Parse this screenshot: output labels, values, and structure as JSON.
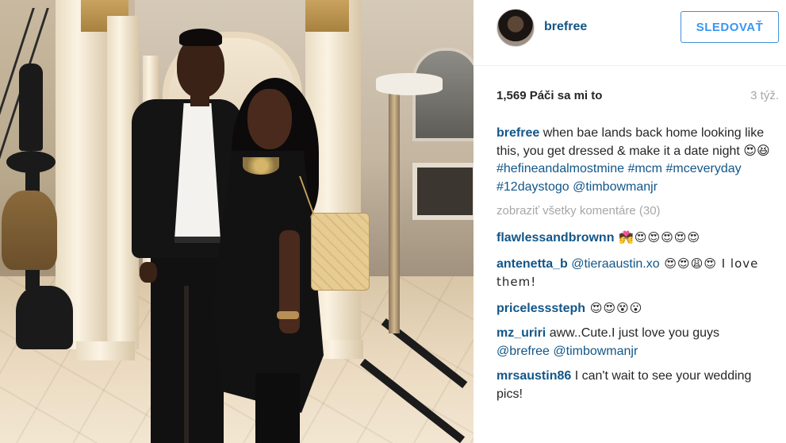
{
  "post": {
    "photo_alt": "Photo"
  },
  "header": {
    "username": "brefree",
    "follow_label": "SLEDOVAŤ"
  },
  "stats": {
    "likes": "1,569 Páči sa mi to",
    "time": "3 týž."
  },
  "caption": {
    "user": "brefree",
    "text": " when bae lands back home looking like this, you get dressed & make it a date night 😍😆 ",
    "tags": [
      "#hefineandalmostmine",
      "#mcm",
      "#mceveryday",
      "#12daystogo",
      "@timbowmanjr"
    ]
  },
  "load_more": "zobraziť všetky komentáre (30)",
  "comments": [
    {
      "user": "flawlessandbrownn",
      "text": " 💏😍😍😍😍😍"
    },
    {
      "user": "antenetta_b",
      "mention": " @tieraaustin.xo",
      "text": " 😍😍😩😍 I love them!"
    },
    {
      "user": "pricelesssteph",
      "text": " 😍😍😵😮"
    },
    {
      "user": "mz_uriri",
      "text": " aww..Cute.I just love you guys ",
      "mentions": "@brefree @timbowmanjr"
    },
    {
      "user": "mrsaustin86",
      "text": " I can't wait to see your wedding pics!"
    }
  ],
  "colors": {
    "link": "#125688",
    "follow": "#3897f0",
    "muted": "#a5a7aa"
  }
}
